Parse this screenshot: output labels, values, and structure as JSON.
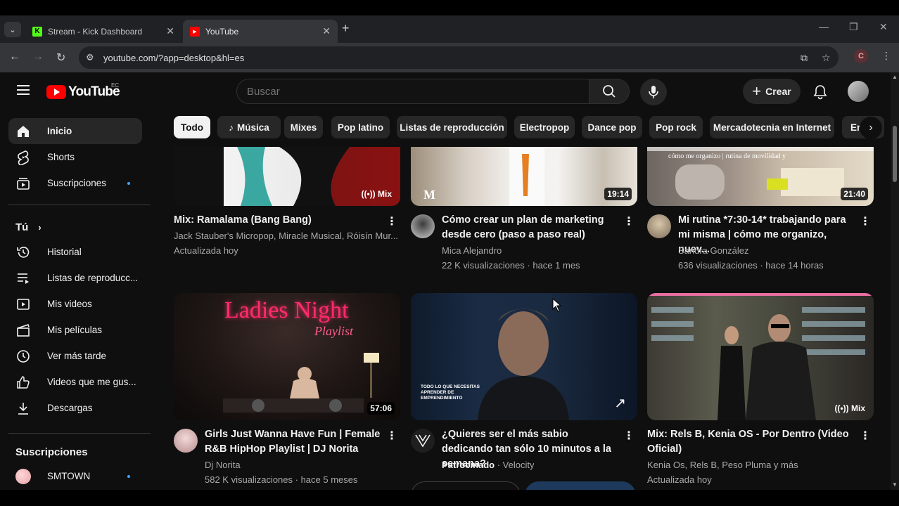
{
  "browser": {
    "tabs": [
      {
        "title": "Stream - Kick Dashboard",
        "favicon": "kick-logo-icon"
      },
      {
        "title": "YouTube",
        "favicon": "youtube-logo-icon"
      }
    ],
    "url": "youtube.com/?app=desktop&hl=es",
    "profile_initial": "C"
  },
  "masthead": {
    "logo_text": "YouTube",
    "region": "EC",
    "search_placeholder": "Buscar",
    "create_label": "Crear"
  },
  "sidebar": {
    "main": [
      {
        "label": "Inicio",
        "icon": "home-icon",
        "active": true
      },
      {
        "label": "Shorts",
        "icon": "shorts-icon"
      },
      {
        "label": "Suscripciones",
        "icon": "subscriptions-icon",
        "dot": true
      }
    ],
    "you_label": "Tú",
    "you": [
      {
        "label": "Historial",
        "icon": "history-icon"
      },
      {
        "label": "Listas de reproducc...",
        "icon": "playlists-icon"
      },
      {
        "label": "Mis videos",
        "icon": "my-videos-icon"
      },
      {
        "label": "Mis películas",
        "icon": "movies-icon"
      },
      {
        "label": "Ver más tarde",
        "icon": "watch-later-icon"
      },
      {
        "label": "Videos que me gus...",
        "icon": "like-icon"
      },
      {
        "label": "Descargas",
        "icon": "download-icon"
      }
    ],
    "subscriptions_heading": "Suscripciones",
    "subscriptions": [
      {
        "label": "SMTOWN",
        "dot": true
      }
    ]
  },
  "chips": [
    "Todo",
    "Música",
    "Mixes",
    "Pop latino",
    "Listas de reproducción",
    "Electropop",
    "Dance pop",
    "Pop rock",
    "Mercadotecnia en Internet",
    "En"
  ],
  "videos": [
    {
      "title": "Mix: Ramalama (Bang Bang)",
      "line1": "Jack Stauber's Micropop, Miracle Musical, Róisín Mur...",
      "line2": "Actualizada hoy",
      "badge": "Mix"
    },
    {
      "title": "Cómo crear un plan de marketing desde cero (paso a paso real)",
      "line1": "Mica Alejandro",
      "line2": "22 K visualizaciones · hace 1 mes",
      "badge": "19:14"
    },
    {
      "title": "Mi rutina *7:30-14* trabajando para mi misma | cómo me organizo, nuev...",
      "line1": "Sandra González",
      "line2": "636 visualizaciones · hace 14 horas",
      "badge": "21:40",
      "thumb_text": "cómo me organizo | rutina de movilidad y"
    },
    {
      "title": "Girls Just Wanna Have Fun | Female R&B HipHop Playlist | DJ Norita",
      "line1": "Dj Norita",
      "line2": "582 K visualizaciones · hace 5 meses",
      "badge": "57:06",
      "thumb_text": "Ladies Night",
      "thumb_text2": "Playlist"
    },
    {
      "title": "¿Quieres ser el más sabio dedicando tan sólo 10 minutos a la semana?",
      "line1_bold": "Patrocinado",
      "line1_rest": " · Velocity",
      "thumb_text": "TODO LO QUE NECESITAS APRENDER DE EMPRENDIMIENTO"
    },
    {
      "title": "Mix: Rels B, Kenia OS - Por Dentro (Video Oficial)",
      "line1": "Kenia Os, Rels B, Peso Pluma y más",
      "line2": "Actualizada hoy",
      "badge": "Mix"
    }
  ]
}
